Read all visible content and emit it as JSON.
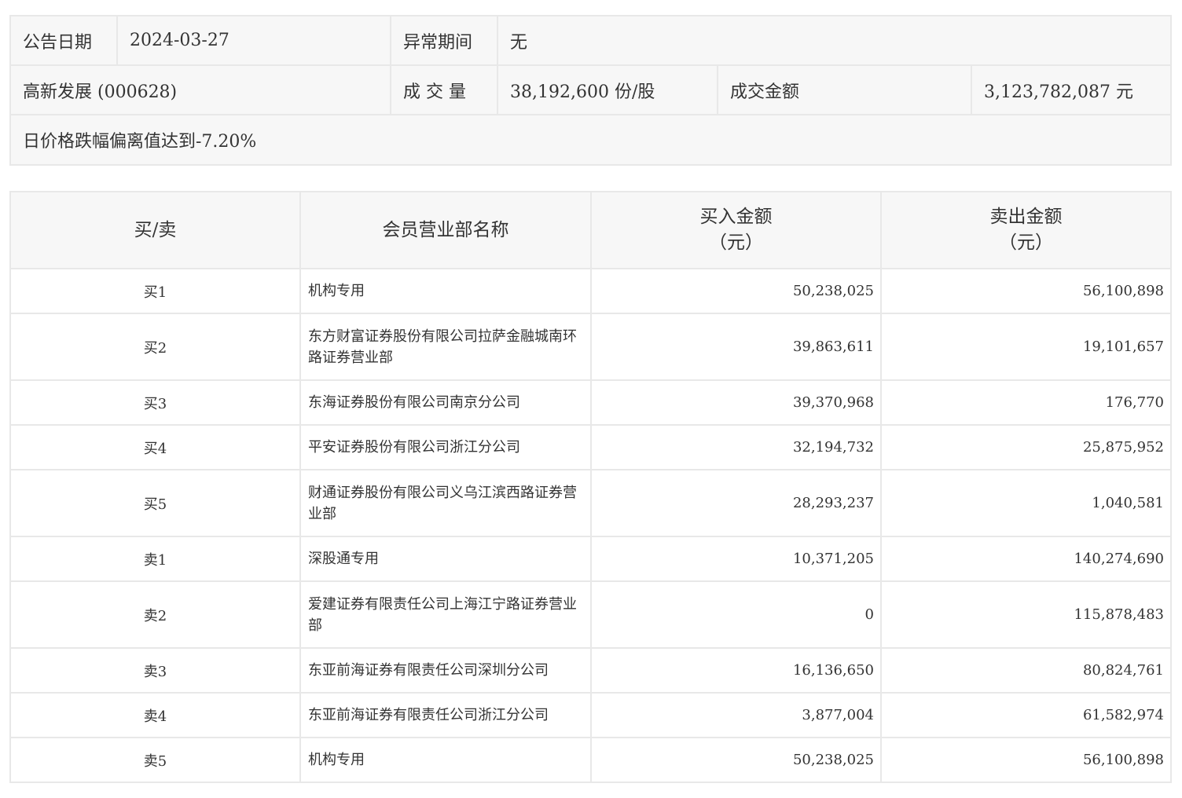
{
  "info": {
    "date_label": "公告日期",
    "date_value": "2024-03-27",
    "period_label": "异常期间",
    "period_value": "无",
    "stock": "高新发展 (000628)",
    "volume_label": "成 交 量",
    "volume_value": "38,192,600 份/股",
    "amount_label": "成交金额",
    "amount_value": "3,123,782,087 元",
    "reason": "日价格跌幅偏离值达到-7.20%"
  },
  "ranking": {
    "headers": {
      "side": "买/卖",
      "name": "会员营业部名称",
      "buy_line1": "买入金额",
      "buy_line2": "（元）",
      "sell_line1": "卖出金额",
      "sell_line2": "（元）"
    },
    "rows": [
      {
        "side": "买1",
        "name": "机构专用",
        "buy": "50,238,025",
        "sell": "56,100,898"
      },
      {
        "side": "买2",
        "name": "东方财富证券股份有限公司拉萨金融城南环路证券营业部",
        "buy": "39,863,611",
        "sell": "19,101,657"
      },
      {
        "side": "买3",
        "name": "东海证券股份有限公司南京分公司",
        "buy": "39,370,968",
        "sell": "176,770"
      },
      {
        "side": "买4",
        "name": "平安证券股份有限公司浙江分公司",
        "buy": "32,194,732",
        "sell": "25,875,952"
      },
      {
        "side": "买5",
        "name": "财通证券股份有限公司义乌江滨西路证券营业部",
        "buy": "28,293,237",
        "sell": "1,040,581"
      },
      {
        "side": "卖1",
        "name": "深股通专用",
        "buy": "10,371,205",
        "sell": "140,274,690"
      },
      {
        "side": "卖2",
        "name": "爱建证券有限责任公司上海江宁路证券营业部",
        "buy": "0",
        "sell": "115,878,483"
      },
      {
        "side": "卖3",
        "name": "东亚前海证券有限责任公司深圳分公司",
        "buy": "16,136,650",
        "sell": "80,824,761"
      },
      {
        "side": "卖4",
        "name": "东亚前海证券有限责任公司浙江分公司",
        "buy": "3,877,004",
        "sell": "61,582,974"
      },
      {
        "side": "卖5",
        "name": "机构专用",
        "buy": "50,238,025",
        "sell": "56,100,898"
      }
    ]
  }
}
